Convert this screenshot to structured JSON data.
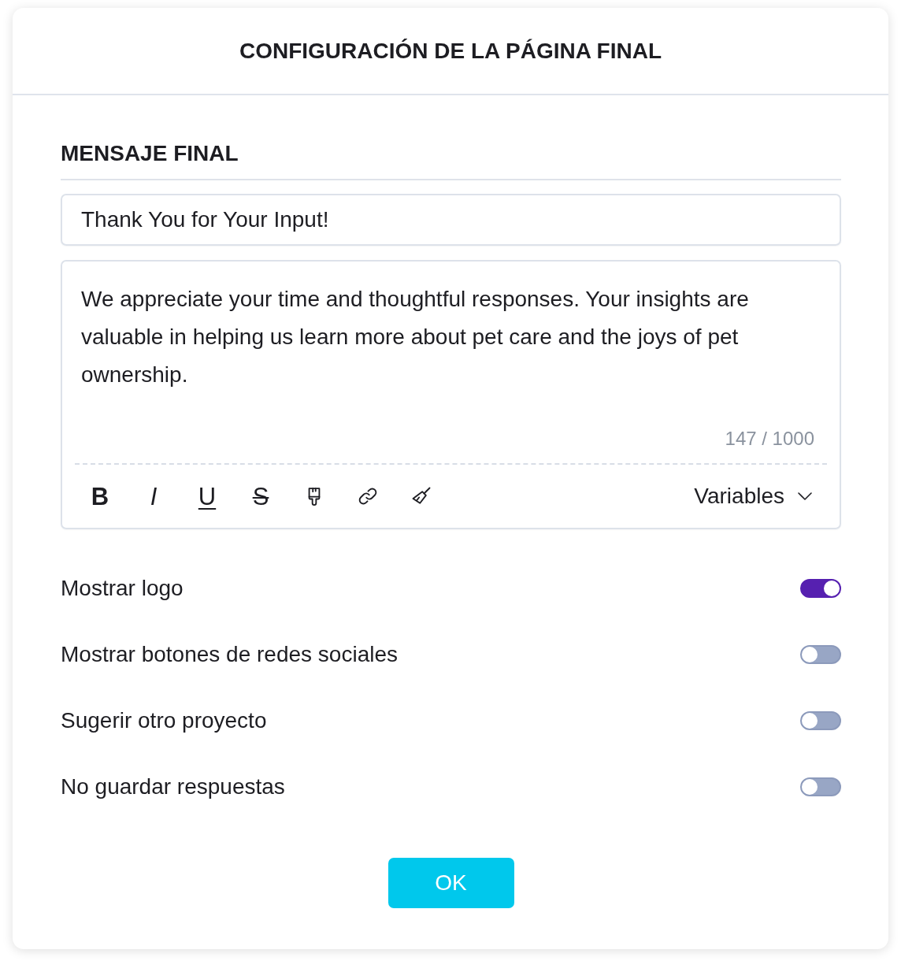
{
  "dialog": {
    "title": "CONFIGURACIÓN DE LA PÁGINA FINAL"
  },
  "section": {
    "title": "MENSAJE FINAL"
  },
  "message": {
    "title_value": "Thank You for Your Input!",
    "body_value": "We appreciate your time and thoughtful responses. Your insights are valuable in helping us learn more about pet care and the joys of pet ownership.",
    "counter": "147 / 1000"
  },
  "toolbar": {
    "tools": [
      {
        "kind": "bold",
        "label": "B"
      },
      {
        "kind": "italic",
        "label": "I"
      },
      {
        "kind": "underline",
        "label": "U"
      },
      {
        "kind": "strikethrough",
        "label": "S"
      },
      {
        "kind": "brush"
      },
      {
        "kind": "link"
      },
      {
        "kind": "clear"
      }
    ],
    "dropdown": {
      "label": "Variables"
    }
  },
  "options": [
    {
      "label": "Mostrar logo",
      "on": true
    },
    {
      "label": "Mostrar botones de redes sociales",
      "on": false
    },
    {
      "label": "Sugerir otro proyecto",
      "on": false
    },
    {
      "label": "No guardar respuestas",
      "on": false
    }
  ],
  "buttons": [
    {
      "label": "OK"
    }
  ]
}
